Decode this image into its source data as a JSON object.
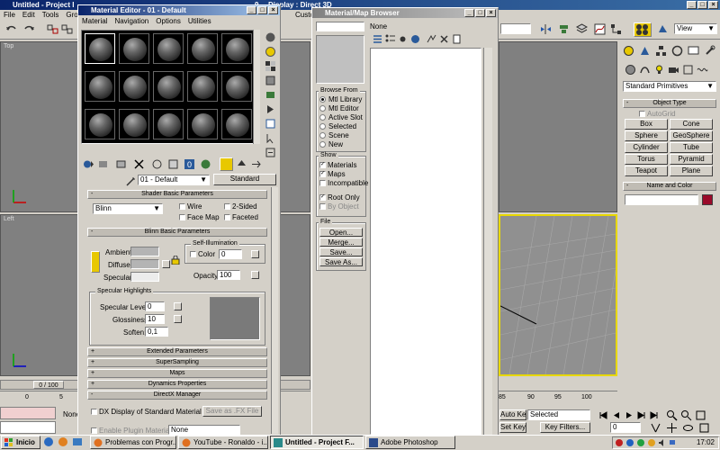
{
  "main_window": {
    "title": "Untitled   - Project I",
    "title_right": "Display : Direct 3D",
    "partial_title": "9",
    "menu": [
      "File",
      "Edit",
      "Tools",
      "Group"
    ],
    "menu_right": "Custo",
    "view_dropdown": "View"
  },
  "viewports": {
    "top": "Top",
    "left": "Left"
  },
  "material_editor": {
    "title": "Material Editor - 01 - Default",
    "menu": [
      "Material",
      "Navigation",
      "Options",
      "Utilities"
    ],
    "material_name": "01 - Default",
    "type_button": "Standard",
    "rollouts": {
      "shader_basic": "Shader Basic Parameters",
      "blinn_basic": "Blinn Basic Parameters",
      "extended": "Extended Parameters",
      "supersampling": "SuperSampling",
      "maps": "Maps",
      "dynamics": "Dynamics Properties",
      "directx": "DirectX Manager"
    },
    "shader": {
      "value": "Blinn",
      "wire": "Wire",
      "two_sided": "2-Sided",
      "face_map": "Face Map",
      "faceted": "Faceted"
    },
    "blinn": {
      "ambient": "Ambient:",
      "diffuse": "Diffuse:",
      "specular": "Specular:",
      "self_illum": "Self-Illumination",
      "color": "Color",
      "color_value": "0",
      "opacity": "Opacity:",
      "opacity_value": "100",
      "spec_highlights": "Specular Highlights",
      "spec_level": "Specular Level:",
      "spec_level_value": "0",
      "glossiness": "Glossiness:",
      "glossiness_value": "10",
      "soften": "Soften:",
      "soften_value": "0,1",
      "ambient_color": "#b4b4b4",
      "diffuse_color": "#b4b4b4",
      "specular_color": "#ececec"
    },
    "directx": {
      "dx_display": "DX Display of Standard Material",
      "save_fx": "Save as .FX File",
      "enable_plugin": "Enable Plugin Material",
      "plugin_value": "None"
    }
  },
  "map_browser": {
    "title": "Material/Map Browser",
    "name_value": "None",
    "browse_from": "Browse From",
    "browse_options": [
      {
        "label": "Mtl Library",
        "selected": true
      },
      {
        "label": "Mtl Editor",
        "selected": false
      },
      {
        "label": "Active Slot",
        "selected": false
      },
      {
        "label": "Selected",
        "selected": false
      },
      {
        "label": "Scene",
        "selected": false
      },
      {
        "label": "New",
        "selected": false
      }
    ],
    "show": "Show",
    "show_options": [
      {
        "label": "Materials",
        "checked": true
      },
      {
        "label": "Maps",
        "checked": true
      },
      {
        "label": "Incompatible",
        "checked": false
      }
    ],
    "root_only": "Root Only",
    "by_object": "By Object",
    "file": "File",
    "file_buttons": [
      "Open...",
      "Merge...",
      "Save...",
      "Save As..."
    ]
  },
  "command_panel": {
    "category": "Standard Primitives",
    "object_type": "Object Type",
    "autogrid": "AutoGrid",
    "buttons": [
      "Box",
      "Cone",
      "Sphere",
      "GeoSphere",
      "Cylinder",
      "Tube",
      "Torus",
      "Pyramid",
      "Teapot",
      "Plane"
    ],
    "name_color": "Name and Color",
    "color": "#9a0a2a"
  },
  "timeline": {
    "frame": "0 / 100",
    "ticks_left": [
      "0",
      "5"
    ],
    "ticks_right": [
      "85",
      "90",
      "95",
      "100"
    ],
    "auto_key": "Auto Key",
    "set_key": "Set Key",
    "selected": "Selected",
    "key_filters": "Key Filters...",
    "frame_value": "0",
    "none_partial": "None"
  },
  "taskbar": {
    "start": "Inicio",
    "tasks": [
      {
        "label": "Problemas con Progr...",
        "active": false
      },
      {
        "label": "YouTube - Ronaldo - i...",
        "active": false
      },
      {
        "label": "Untitled   - Project F...",
        "active": true
      },
      {
        "label": "Adobe Photoshop",
        "active": false
      }
    ],
    "clock": "17:02"
  }
}
